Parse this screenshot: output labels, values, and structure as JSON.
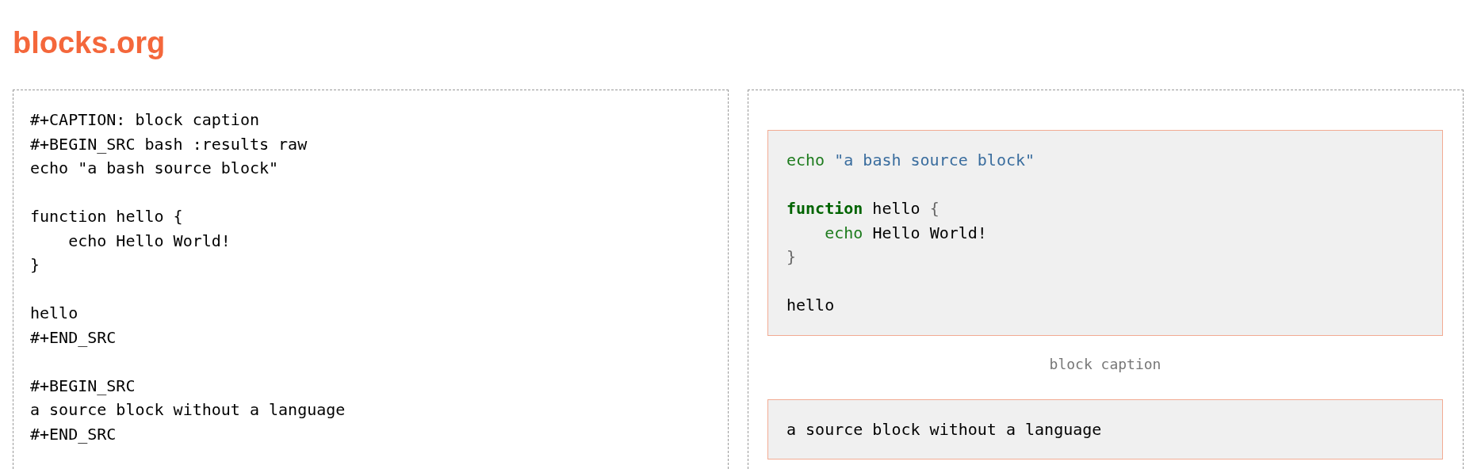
{
  "header": {
    "title": "blocks.org"
  },
  "source_panel": {
    "text": "#+CAPTION: block caption\n#+BEGIN_SRC bash :results raw\necho \"a bash source block\"\n\nfunction hello {\n    echo Hello World!\n}\n\nhello\n#+END_SRC\n\n#+BEGIN_SRC\na source block without a language\n#+END_SRC"
  },
  "rendered_panel": {
    "blocks": [
      {
        "kind": "code",
        "tokens": [
          {
            "kind": "builtin",
            "text": "echo"
          },
          {
            "kind": "string",
            "text": " \"a bash source block\"\n\n"
          },
          {
            "kind": "keyword",
            "text": "function"
          },
          {
            "kind": "plain",
            "text": " hello "
          },
          {
            "kind": "punct",
            "text": "{\n    "
          },
          {
            "kind": "builtin",
            "text": "echo"
          },
          {
            "kind": "plain",
            "text": " Hello World!\n"
          },
          {
            "kind": "punct",
            "text": "}"
          },
          {
            "kind": "plain",
            "text": "\n\nhello"
          }
        ]
      },
      {
        "kind": "caption",
        "text": "block caption"
      },
      {
        "kind": "code",
        "tokens": [
          {
            "kind": "plain",
            "text": "a source block without a language"
          }
        ]
      }
    ]
  }
}
